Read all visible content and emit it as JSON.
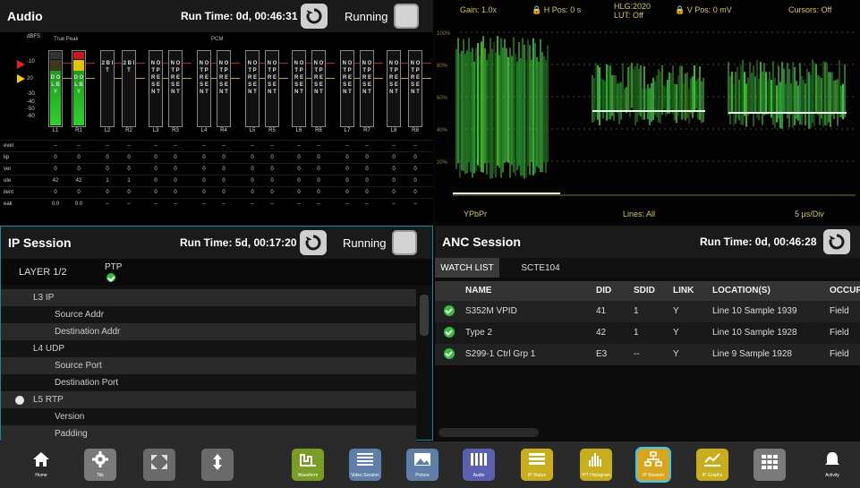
{
  "audio": {
    "title": "Audio",
    "run_time": "Run Time: 0d, 00:46:31",
    "state": "Running",
    "group_labels": [
      "True Peak",
      "PCM"
    ],
    "scale": [
      "dBFS",
      "-10",
      "20",
      "-30",
      "-40",
      "-50",
      "-60"
    ],
    "meters": [
      {
        "label": "L1",
        "text": "D O L B Y",
        "active": true
      },
      {
        "label": "R1",
        "text": "D O L B Y",
        "active": true
      },
      {
        "label": "L2",
        "text": "2 B I T",
        "active": false
      },
      {
        "label": "R2",
        "text": "2 B I T",
        "active": false
      },
      {
        "label": "L3",
        "text": "N O T P R E S E N T",
        "active": false
      },
      {
        "label": "R3",
        "text": "N O T P R E S E N T",
        "active": false
      },
      {
        "label": "L4",
        "text": "N O T P R E S E N T",
        "active": false
      },
      {
        "label": "R4",
        "text": "N O T P R E S E N T",
        "active": false
      },
      {
        "label": "L5",
        "text": "N O T P R E S E N T",
        "active": false
      },
      {
        "label": "R5",
        "text": "N O T P R E S E N T",
        "active": false
      },
      {
        "label": "L6",
        "text": "N O T P R E S E N T",
        "active": false
      },
      {
        "label": "R6",
        "text": "N O T P R E S E N T",
        "active": false
      },
      {
        "label": "L7",
        "text": "N O T P R E S E N T",
        "active": false
      },
      {
        "label": "R7",
        "text": "N O T P R E S E N T",
        "active": false
      },
      {
        "label": "L8",
        "text": "N O T P R E S E N T",
        "active": false
      },
      {
        "label": "R8",
        "text": "N O T P R E S E N T",
        "active": false
      }
    ],
    "rows": [
      {
        "label": "evel",
        "values": [
          "--",
          "--",
          "--",
          "--",
          "--",
          "--",
          "--",
          "--",
          "--",
          "--",
          "--",
          "--",
          "--",
          "--",
          "--",
          "--"
        ]
      },
      {
        "label": "lip",
        "values": [
          "0",
          "0",
          "0",
          "0",
          "0",
          "0",
          "0",
          "0",
          "0",
          "0",
          "0",
          "0",
          "0",
          "0",
          "0",
          "0"
        ]
      },
      {
        "label": "ver",
        "values": [
          "0",
          "0",
          "0",
          "0",
          "0",
          "0",
          "0",
          "0",
          "0",
          "0",
          "0",
          "0",
          "0",
          "0",
          "0",
          "0"
        ]
      },
      {
        "label": "ute",
        "values": [
          "42",
          "42",
          "1",
          "1",
          "0",
          "0",
          "0",
          "0",
          "0",
          "0",
          "0",
          "0",
          "0",
          "0",
          "0",
          "0"
        ]
      },
      {
        "label": "ilent",
        "values": [
          "0",
          "0",
          "0",
          "0",
          "0",
          "0",
          "0",
          "0",
          "0",
          "0",
          "0",
          "0",
          "0",
          "0",
          "0",
          "0"
        ]
      },
      {
        "label": "eak",
        "values": [
          "0.0",
          "0.0",
          "--",
          "--",
          "--",
          "--",
          "--",
          "--",
          "--",
          "--",
          "--",
          "--",
          "--",
          "--",
          "--",
          "--"
        ]
      }
    ]
  },
  "waveform": {
    "header": [
      "Gain: 1.0x",
      "H Pos: 0 s",
      "HLG:2020",
      "LUT: Off",
      "V Pos: 0 mV",
      "Cursors: Off"
    ],
    "scale": [
      "100%",
      "80%",
      "60%",
      "40%",
      "20%"
    ],
    "footer": [
      "YPbPr",
      "Lines: All",
      "5 µs/Div"
    ]
  },
  "ip_session": {
    "title": "IP Session",
    "run_time": "Run Time: 5d, 00:17:20",
    "state": "Running",
    "layer": "LAYER 1/2",
    "ptp": "PTP",
    "rows": [
      {
        "text": "L3 IP",
        "indent": 1
      },
      {
        "text": "Source Addr",
        "indent": 2
      },
      {
        "text": "Destination Addr",
        "indent": 2
      },
      {
        "text": "L4 UDP",
        "indent": 1
      },
      {
        "text": "Source Port",
        "indent": 2
      },
      {
        "text": "Destination Port",
        "indent": 2
      },
      {
        "text": "L5 RTP",
        "indent": 1,
        "dot": true
      },
      {
        "text": "Version",
        "indent": 2
      },
      {
        "text": "Padding",
        "indent": 2
      }
    ]
  },
  "anc_session": {
    "title": "ANC Session",
    "run_time": "Run Time: 0d, 00:46:28",
    "tabs": [
      "WATCH LIST",
      "SCTE104"
    ],
    "columns": [
      "NAME",
      "DID",
      "SDID",
      "LINK",
      "LOCATION(S)",
      "OCCUR"
    ],
    "rows": [
      {
        "name": "S352M VPID",
        "did": "41",
        "sdid": "1",
        "link": "Y",
        "location": "Line 10 Sample 1939",
        "occur": "Field"
      },
      {
        "name": "Type 2",
        "did": "42",
        "sdid": "1",
        "link": "Y",
        "location": "Line 10 Sample 1928",
        "occur": "Field"
      },
      {
        "name": "S299-1 Ctrl Grp 1",
        "did": "E3",
        "sdid": "--",
        "link": "Y",
        "location": "Line 9 Sample 1928",
        "occur": "Field"
      }
    ]
  },
  "toolbar": {
    "buttons": [
      {
        "label": "Home",
        "icon": "home-icon"
      },
      {
        "label": "Tile",
        "icon": "gear-icon"
      },
      {
        "label": "",
        "icon": "expand-icon"
      },
      {
        "label": "",
        "icon": "move-icon"
      },
      {
        "label": "Waveform",
        "icon": "waveform-icon"
      },
      {
        "label": "Video Session",
        "icon": "list-icon"
      },
      {
        "label": "Picture",
        "icon": "picture-icon"
      },
      {
        "label": "Audio",
        "icon": "audio-icon"
      },
      {
        "label": "IP Status",
        "icon": "ip-status-icon"
      },
      {
        "label": "IPT Histogram",
        "icon": "histogram-icon"
      },
      {
        "label": "IP Session",
        "icon": "ip-session-icon"
      },
      {
        "label": "IP Graphs",
        "icon": "graphs-icon"
      },
      {
        "label": "",
        "icon": "apps-grid-icon"
      },
      {
        "label": "Activity",
        "icon": "bell-icon"
      }
    ]
  }
}
